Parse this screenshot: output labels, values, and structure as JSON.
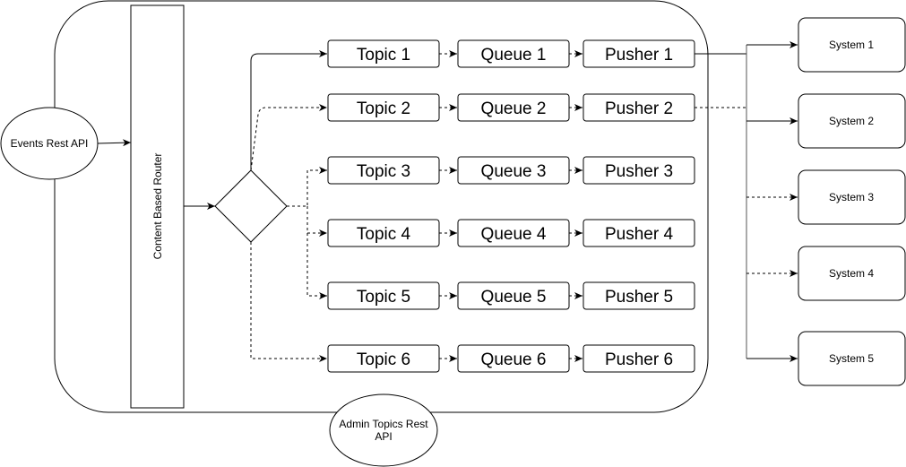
{
  "diagram": {
    "events_api": "Events Rest API",
    "router": "Content Based Router",
    "admin_api_line1": "Admin Topics Rest",
    "admin_api_line2": "API",
    "rows": [
      {
        "topic": "Topic 1",
        "queue": "Queue 1",
        "pusher": "Pusher 1",
        "route_style": "solid"
      },
      {
        "topic": "Topic 2",
        "queue": "Queue 2",
        "pusher": "Pusher 2",
        "route_style": "dashed"
      },
      {
        "topic": "Topic 3",
        "queue": "Queue 3",
        "pusher": "Pusher 3",
        "route_style": "dashed"
      },
      {
        "topic": "Topic 4",
        "queue": "Queue 4",
        "pusher": "Pusher 4",
        "route_style": "dashed"
      },
      {
        "topic": "Topic 5",
        "queue": "Queue 5",
        "pusher": "Pusher 5",
        "route_style": "dashed"
      },
      {
        "topic": "Topic 6",
        "queue": "Queue 6",
        "pusher": "Pusher 6",
        "route_style": "dashed"
      }
    ],
    "systems": [
      {
        "label": "System 1",
        "link_style": "solid"
      },
      {
        "label": "System 2",
        "link_style": "solid"
      },
      {
        "label": "System 3",
        "link_style": "dashed"
      },
      {
        "label": "System 4",
        "link_style": "dashed"
      },
      {
        "label": "System 5",
        "link_style": "solid"
      }
    ]
  }
}
